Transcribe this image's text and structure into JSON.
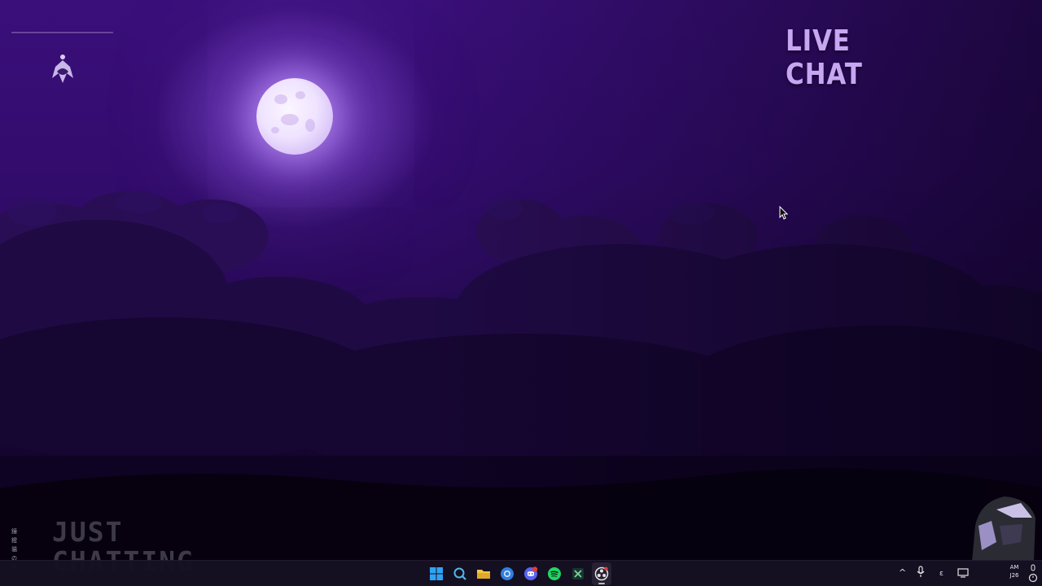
{
  "desktop": {
    "overlay_title": "LIVE CHAT",
    "scene_label_lines": [
      "JUST",
      "CHATTING"
    ],
    "side_glyphs": [
      "鐘",
      "鐙",
      "貓",
      "の",
      "介"
    ]
  },
  "taskbar": {
    "apps": [
      {
        "name": "start-button",
        "icon": "windows-logo-icon",
        "color": "#2fa4f5"
      },
      {
        "name": "search-button",
        "icon": "search-icon",
        "color": "#4fb8e8"
      },
      {
        "name": "file-explorer-button",
        "icon": "folder-icon",
        "color": "#f4c542"
      },
      {
        "name": "browser-button",
        "icon": "browser-icon",
        "color": "#2f7fe0"
      },
      {
        "name": "discord-button",
        "icon": "discord-icon",
        "color": "#5865f2",
        "badge": "5+"
      },
      {
        "name": "spotify-button",
        "icon": "spotify-icon",
        "color": "#1ed760"
      },
      {
        "name": "excel-button",
        "icon": "excel-icon",
        "color": "#1f7a46"
      },
      {
        "name": "obs-button",
        "icon": "obs-icon",
        "color": "#e6e6e6"
      }
    ],
    "tray": {
      "chevron": "^",
      "mic_icon": "microphone-icon",
      "lang": "ɛ",
      "time_line1": "AM",
      "time_line2": "J26"
    }
  },
  "colors": {
    "accent": "#c7a6f2",
    "sky_top": "#3a0f7a",
    "sky_bottom": "#09021a"
  }
}
